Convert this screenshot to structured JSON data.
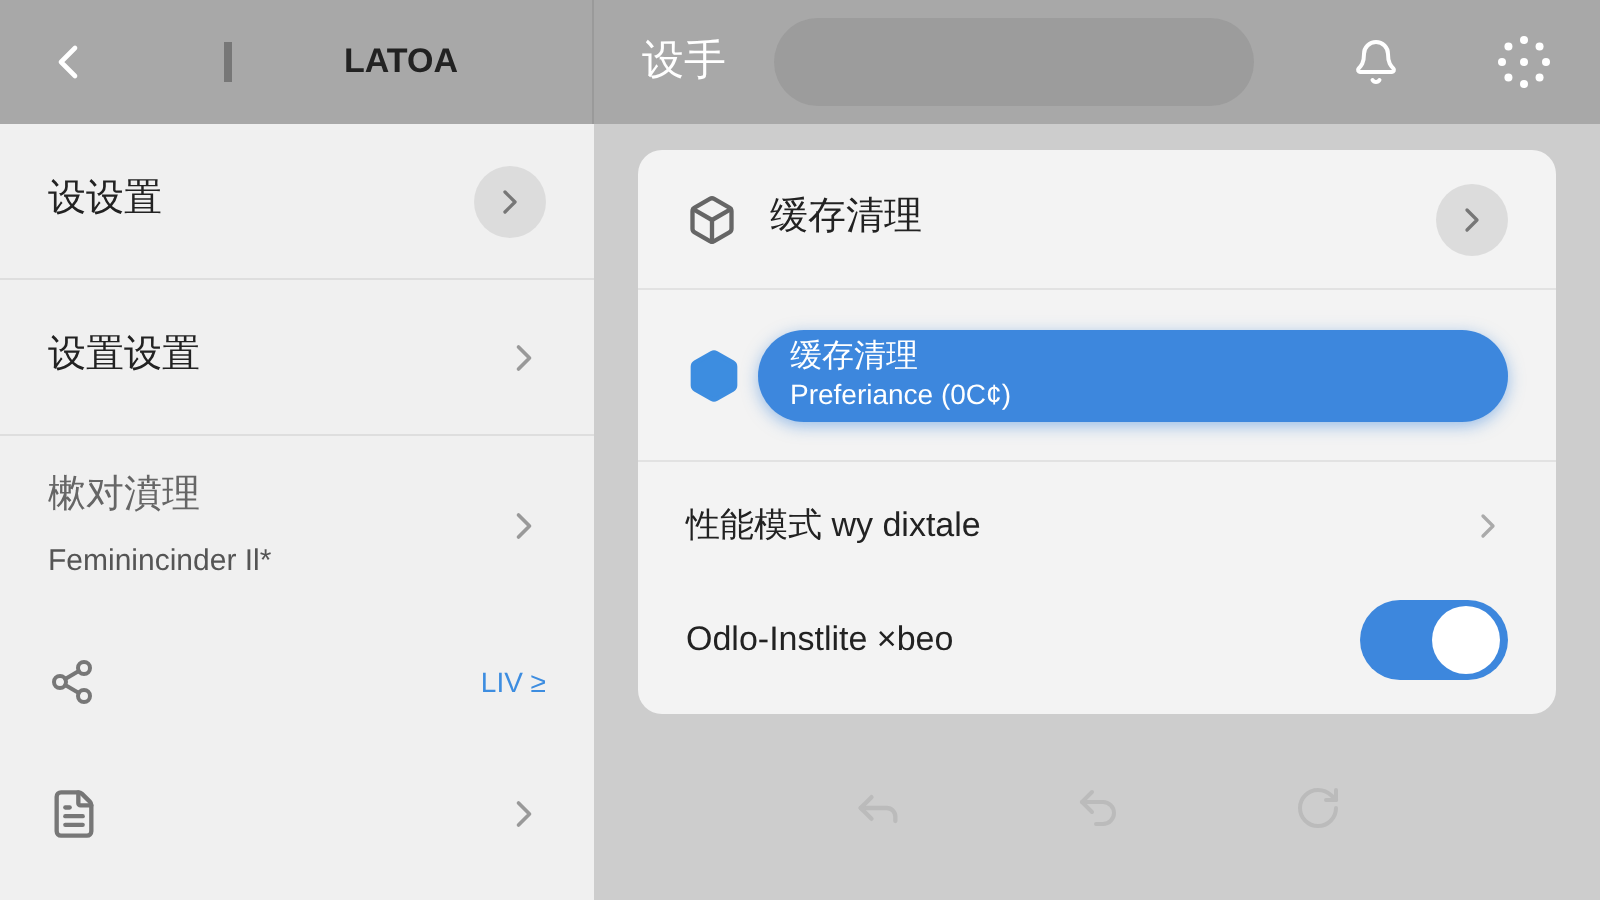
{
  "top_bar": {
    "title": "LATOA",
    "section_title": "设手"
  },
  "sidebar": {
    "items": [
      {
        "kind": "circle-chevron",
        "label": "设设置"
      },
      {
        "kind": "chevron",
        "label": "设置设置"
      },
      {
        "kind": "subtitle",
        "label": "樕对濆理",
        "subtitle": "Feminincinder Il*"
      },
      {
        "kind": "share-badge",
        "badge": "LIV ≥"
      },
      {
        "kind": "document-chevron"
      }
    ]
  },
  "card": {
    "title": "缓存清理",
    "rows": [
      {
        "kind": "pill",
        "label": "缓存清理",
        "subtitle": "Preferiance (0C¢)"
      },
      {
        "kind": "chevron",
        "label": "性能模式 wy dixtale"
      },
      {
        "kind": "toggle",
        "label": "Odlo-Instlite ×beo",
        "on": true
      }
    ]
  }
}
